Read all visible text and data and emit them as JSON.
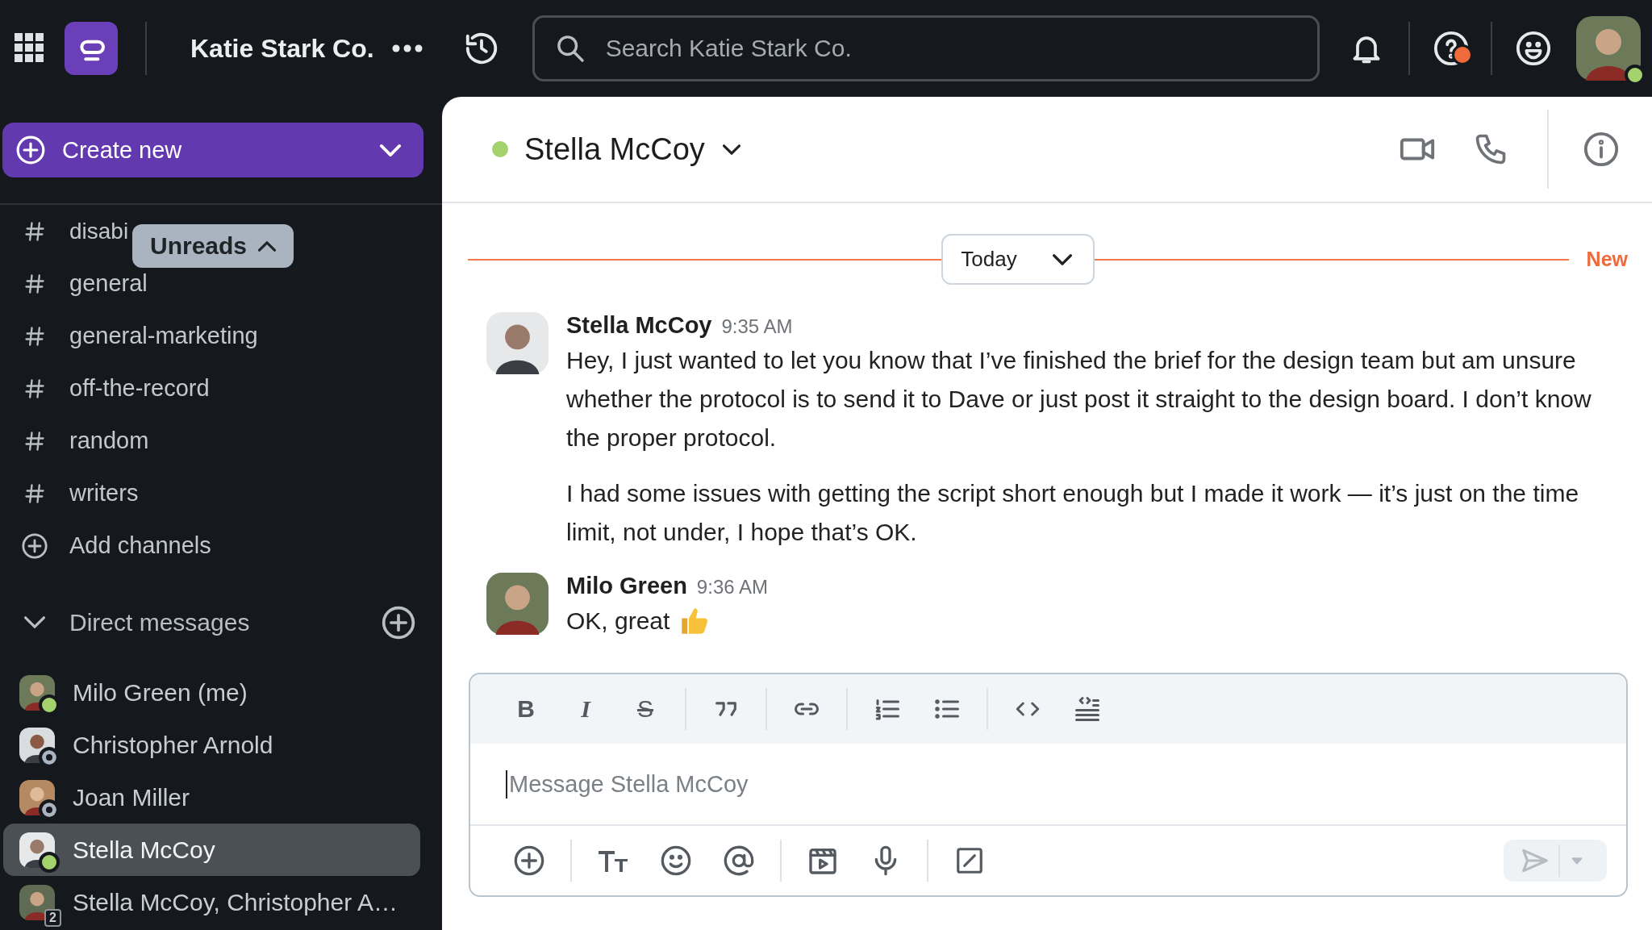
{
  "topbar": {
    "workspace": "Katie Stark Co.",
    "search": {
      "placeholder": "Search Katie Stark Co."
    },
    "help_alert": true,
    "user_online": true
  },
  "sidebar": {
    "create_button": "Create new",
    "unreads_pill": "Unreads",
    "channels": [
      {
        "name": "disabi"
      },
      {
        "name": "general"
      },
      {
        "name": "general-marketing"
      },
      {
        "name": "off-the-record"
      },
      {
        "name": "random"
      },
      {
        "name": "writers"
      }
    ],
    "add_channels": "Add channels",
    "direct_messages": {
      "title": "Direct messages",
      "expanded": true,
      "items": [
        {
          "name": "Milo Green (me)",
          "kind": "person",
          "online": true,
          "selected": false
        },
        {
          "name": "Christopher Arnold",
          "kind": "person",
          "online": false,
          "selected": false
        },
        {
          "name": "Joan Miller",
          "kind": "person",
          "online": false,
          "selected": false
        },
        {
          "name": "Stella McCoy",
          "kind": "person",
          "online": true,
          "selected": true
        },
        {
          "name": "Stella McCoy, Christopher A…",
          "kind": "group",
          "count": "2",
          "selected": false
        }
      ]
    }
  },
  "chat": {
    "contact": {
      "name": "Stella McCoy",
      "online": true
    },
    "divider": {
      "label": "Today",
      "new_label": "New"
    },
    "messages": [
      {
        "author": "Stella McCoy",
        "time": "9:35 AM",
        "paragraphs": [
          "Hey, I just wanted to let you know that I’ve finished the brief for the design team but am unsure whether the protocol is to send it to Dave or just post it straight to the design board. I don’t know the proper protocol.",
          "I had some issues with getting the script short enough but I made it work — it’s just on the time limit, not under, I hope that’s OK."
        ]
      },
      {
        "author": "Milo Green",
        "time": "9:36 AM",
        "paragraphs": [
          "OK, great"
        ],
        "emoji": true
      }
    ],
    "composer": {
      "format_buttons": [
        {
          "label": "B",
          "kind": "bold"
        },
        {
          "label": "I",
          "kind": "italic"
        },
        {
          "label": "S",
          "kind": "strike"
        }
      ],
      "placeholder": "Message Stella McCoy"
    }
  }
}
